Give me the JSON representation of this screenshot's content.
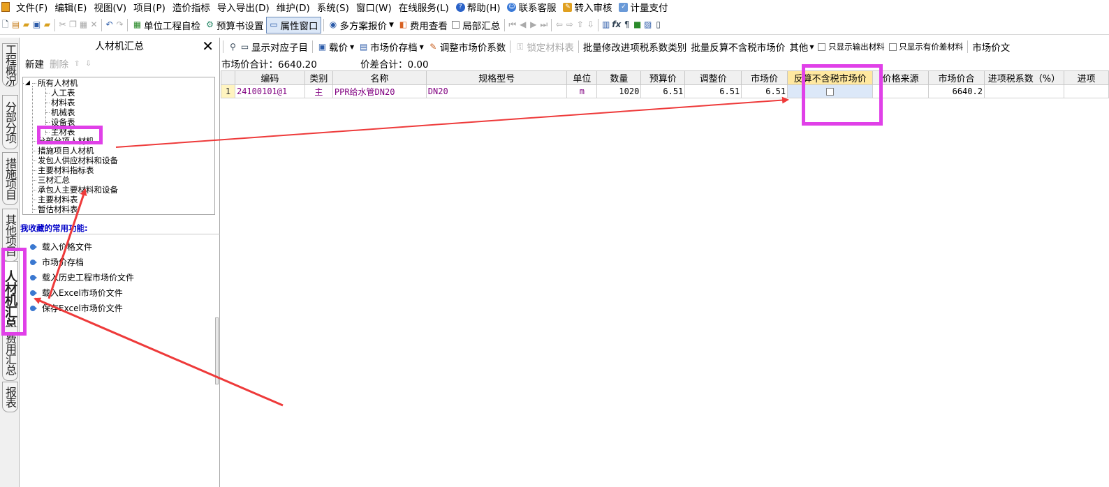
{
  "menu": [
    "文件(F)",
    "编辑(E)",
    "视图(V)",
    "项目(P)",
    "造价指标",
    "导入导出(D)",
    "维护(D)",
    "系统(S)",
    "窗口(W)",
    "在线服务(L)",
    "帮助(H)",
    "联系客服",
    "转入审核",
    "计量支付"
  ],
  "toolbar1": {
    "self_check": "单位工程自检",
    "budget_settings": "预算书设置",
    "property_window": "属性窗口",
    "multi_quote": "多方案报价",
    "fee_view": "费用查看",
    "partial_summary": "局部汇总"
  },
  "sidetabs": [
    "工程概况",
    "分部分项",
    "措施项目",
    "其他项目",
    "人材机汇总",
    "费用汇总",
    "报表"
  ],
  "left_panel": {
    "title": "人材机汇总",
    "new": "新建",
    "delete": "删除",
    "tree_root": "所有人材机",
    "tree": [
      "人工表",
      "材料表",
      "机械表",
      "设备表",
      "主材表",
      "分部分项人材机",
      "措施项目人材机",
      "发包人供应材料和设备",
      "主要材料指标表",
      "三材汇总",
      "承包人主要材料和设备",
      "主要材料表",
      "暂估材料表"
    ],
    "fav_title": "我收藏的常用功能:",
    "favorites": [
      "载入价格文件",
      "市场价存档",
      "载入历史工程市场价文件",
      "载入Excel市场价文件",
      "保存Excel市场价文件"
    ]
  },
  "toolbar2": {
    "show_child": "显示对应子目",
    "load_price": "载价",
    "market_archive": "市场价存档",
    "adjust_coef": "调整市场价系数",
    "lock_material": "锁定材料表",
    "batch_tax": "批量修改进项税系数类别",
    "batch_reverse": "批量反算不含税市场价",
    "other": "其他",
    "only_output": "只显示输出材料",
    "only_diff": "只显示有价差材料",
    "market_file": "市场价文"
  },
  "summary": {
    "market_total_label": "市场价合计：6640.20",
    "diff_total_label": "价差合计：0.00"
  },
  "grid": {
    "headers": [
      "编码",
      "类别",
      "名称",
      "规格型号",
      "单位",
      "数量",
      "预算价",
      "调整价",
      "市场价",
      "反算不含税市场价",
      "价格来源",
      "市场价合",
      "进项税系数（%）",
      "进项"
    ],
    "rows": [
      {
        "no": "1",
        "code": "24100101@1",
        "type": "主",
        "name": "PPR给水管DN20",
        "spec": "DN20",
        "unit": "m",
        "qty": "1020",
        "budget": "6.51",
        "adjusted": "6.51",
        "market": "6.51",
        "reverse": "",
        "source": "",
        "market_total": "6640.2",
        "tax": "",
        "input": ""
      }
    ]
  },
  "colors": {
    "highlight": "#e040e8",
    "arrow": "#ee3a3a"
  }
}
